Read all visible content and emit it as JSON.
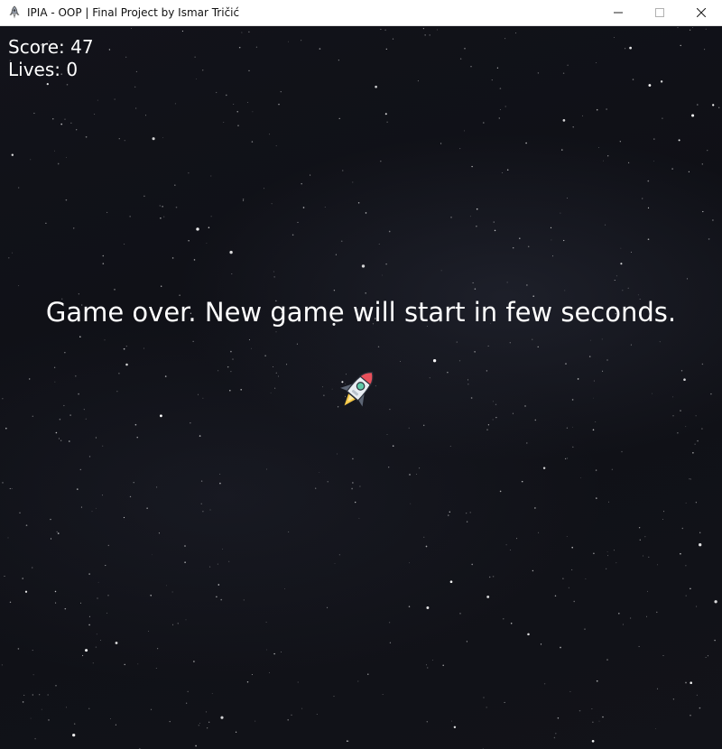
{
  "window": {
    "title": "IPIA - OOP | Final Project by Ismar Tričić",
    "app_icon": "rocket-icon",
    "controls": [
      "minimize-icon",
      "maximize-icon",
      "close-icon"
    ]
  },
  "hud": {
    "score_label": "Score: 47",
    "lives_label": "Lives: 0"
  },
  "game": {
    "message": "Game over. New game will start in few seconds.",
    "player_sprite": "rocket-icon"
  },
  "colors": {
    "background": "#0f1016",
    "text": "#ffffff",
    "rocket_nose": "#e8505b",
    "rocket_body": "#e8edf2",
    "rocket_window": "#5fc9a8",
    "rocket_fin": "#5d6675",
    "rocket_flame": "#f7c948"
  }
}
